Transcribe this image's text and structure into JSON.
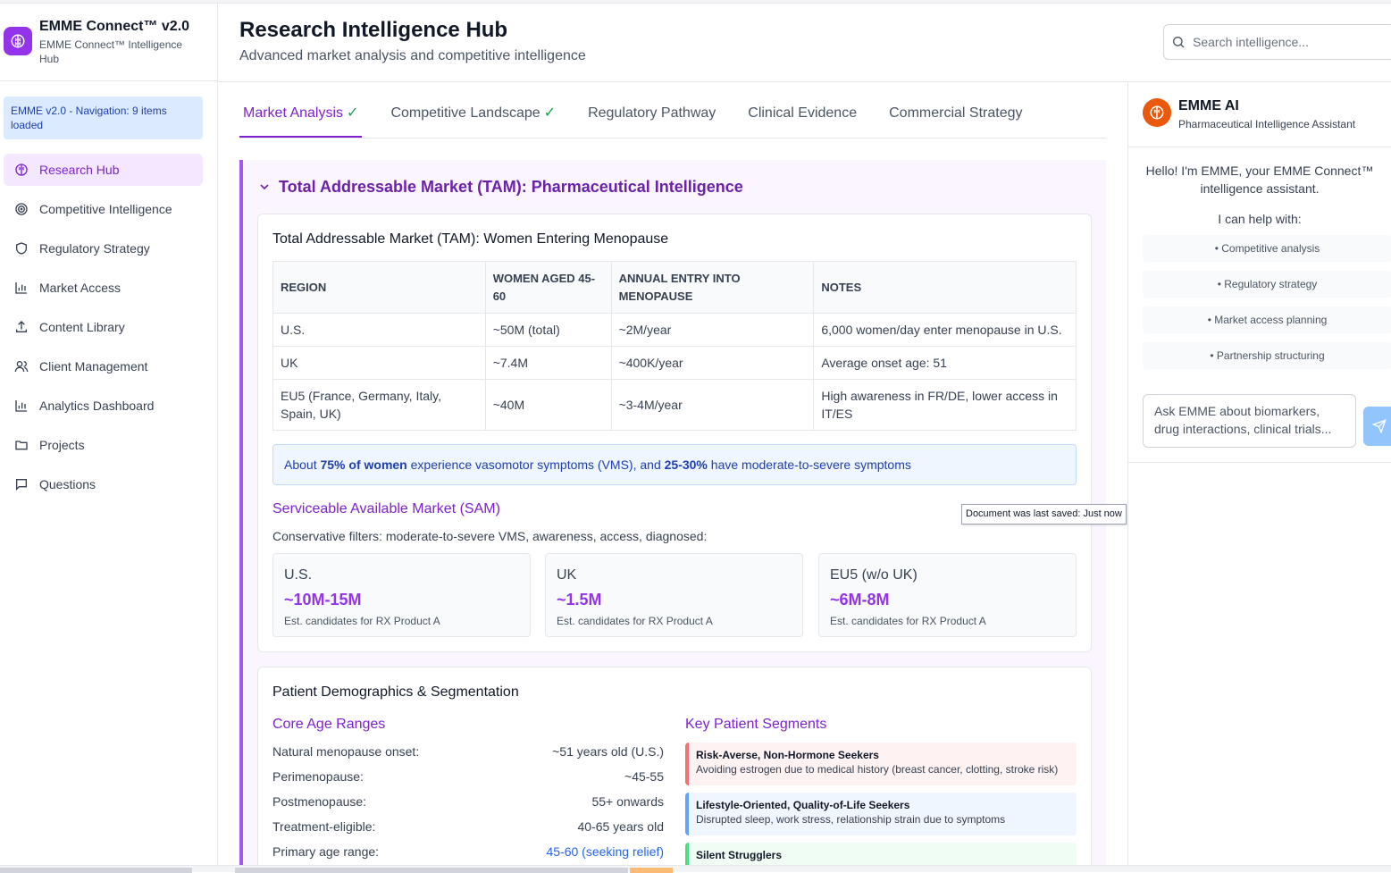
{
  "brand": {
    "title": "EMME Connect™ v2.0",
    "subtitle": "EMME Connect™ Intelligence Hub"
  },
  "notice": "EMME v2.0 - Navigation: 9 items loaded",
  "nav": [
    {
      "label": "Research Hub",
      "icon": "brain-icon",
      "active": true
    },
    {
      "label": "Competitive Intelligence",
      "icon": "target-icon"
    },
    {
      "label": "Regulatory Strategy",
      "icon": "shield-icon"
    },
    {
      "label": "Market Access",
      "icon": "bar-chart-icon"
    },
    {
      "label": "Content Library",
      "icon": "upload-icon"
    },
    {
      "label": "Client Management",
      "icon": "users-icon"
    },
    {
      "label": "Analytics Dashboard",
      "icon": "bar-chart-icon"
    },
    {
      "label": "Projects",
      "icon": "folder-icon"
    },
    {
      "label": "Questions",
      "icon": "message-icon"
    }
  ],
  "header": {
    "title": "Research Intelligence Hub",
    "subtitle": "Advanced market analysis and competitive intelligence",
    "search_placeholder": "Search intelligence..."
  },
  "tabs": [
    {
      "label": "Market Analysis",
      "check": "✓",
      "active": true
    },
    {
      "label": "Competitive Landscape",
      "check": "✓"
    },
    {
      "label": "Regulatory Pathway",
      "check": ""
    },
    {
      "label": "Clinical Evidence",
      "check": ""
    },
    {
      "label": "Commercial Strategy",
      "check": ""
    }
  ],
  "section": {
    "title": "Total Addressable Market (TAM): Pharmaceutical Intelligence"
  },
  "tam": {
    "title": "Total Addressable Market (TAM): Women Entering Menopause",
    "headers": [
      "REGION",
      "WOMEN AGED 45-60",
      "ANNUAL ENTRY INTO MENOPAUSE",
      "NOTES"
    ],
    "rows": [
      [
        "U.S.",
        "~50M (total)",
        "~2M/year",
        "6,000 women/day enter menopause in U.S."
      ],
      [
        "UK",
        "~7.4M",
        "~400K/year",
        "Average onset age: 51"
      ],
      [
        "EU5 (France, Germany, Italy, Spain, UK)",
        "~40M",
        "~3-4M/year",
        "High awareness in FR/DE, lower access in IT/ES"
      ]
    ],
    "info": {
      "pre": "About ",
      "b1": "75% of women",
      "mid": " experience vasomotor symptoms (VMS), and ",
      "b2": "25-30%",
      "post": " have moderate-to-severe symptoms"
    }
  },
  "sam": {
    "title": "Serviceable Available Market (SAM)",
    "desc": "Conservative filters: moderate-to-severe VMS, awareness, access, diagnosed:",
    "boxes": [
      {
        "region": "U.S.",
        "value": "~10M-15M",
        "note": "Est. candidates for RX Product A"
      },
      {
        "region": "UK",
        "value": "~1.5M",
        "note": "Est. candidates for RX Product A"
      },
      {
        "region": "EU5 (w/o UK)",
        "value": "~6M-8M",
        "note": "Est. candidates for RX Product A"
      }
    ]
  },
  "tooltip": "Document was last saved: Just now",
  "demographics": {
    "title": "Patient Demographics & Segmentation",
    "ages_title": "Core Age Ranges",
    "ages": [
      {
        "label": "Natural menopause onset:",
        "value": "~51 years old (U.S.)"
      },
      {
        "label": "Perimenopause:",
        "value": "~45-55"
      },
      {
        "label": "Postmenopause:",
        "value": "55+ onwards"
      },
      {
        "label": "Treatment-eligible:",
        "value": "40-65 years old"
      },
      {
        "label": "Primary age range:",
        "value": "45-60 (seeking relief)"
      }
    ],
    "segments_title": "Key Patient Segments",
    "segments": [
      {
        "title": "Risk-Averse, Non-Hormone Seekers",
        "desc": "Avoiding estrogen due to medical history (breast cancer, clotting, stroke risk)",
        "color": "#f87171",
        "bg": "#fef2f2"
      },
      {
        "title": "Lifestyle-Oriented, Quality-of-Life Seekers",
        "desc": "Disrupted sleep, work stress, relationship strain due to symptoms",
        "color": "#60a5fa",
        "bg": "#eff6ff"
      },
      {
        "title": "Silent Strugglers",
        "desc": "",
        "color": "#4ade80",
        "bg": "#f0fdf4"
      }
    ]
  },
  "ai": {
    "name": "EMME AI",
    "subtitle": "Pharmaceutical Intelligence Assistant",
    "greeting": "Hello! I'm EMME, your EMME Connect™ intelligence assistant.",
    "help": "I can help with:",
    "chips": [
      "• Competitive analysis",
      "• Regulatory strategy",
      "• Market access planning",
      "• Partnership structuring"
    ],
    "input_placeholder": "Ask EMME about biomarkers, drug interactions, clinical trials..."
  },
  "colors": {
    "accent": "#7e22ce",
    "brand": "#9333ea",
    "ai_logo": "#ea580c"
  }
}
